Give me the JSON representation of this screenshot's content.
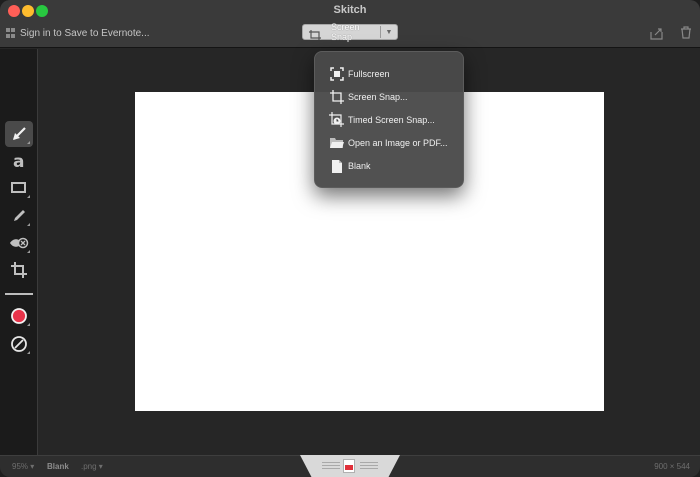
{
  "window": {
    "title": "Skitch"
  },
  "toolbar": {
    "signin_label": "Sign in to Save to Evernote...",
    "capture_button_label": "Screen Snap"
  },
  "menu": {
    "items": [
      {
        "label": "Fullscreen",
        "icon": "fullscreen-icon"
      },
      {
        "label": "Screen Snap...",
        "icon": "screen-snap-icon"
      },
      {
        "label": "Timed Screen Snap...",
        "icon": "timer-icon"
      },
      {
        "label": "Open an Image or PDF...",
        "icon": "folder-icon"
      },
      {
        "label": "Blank",
        "icon": "document-icon"
      }
    ]
  },
  "tools": [
    {
      "name": "arrow-tool",
      "selected": true
    },
    {
      "name": "text-tool"
    },
    {
      "name": "shape-tool"
    },
    {
      "name": "pen-tool"
    },
    {
      "name": "pixelate-tool"
    },
    {
      "name": "crop-tool"
    },
    {
      "name": "color-picker"
    },
    {
      "name": "stroke-size-picker"
    }
  ],
  "colors": {
    "accent_color": "#e8334a",
    "canvas": "#ffffff"
  },
  "statusbar": {
    "zoom": "95% ▾",
    "filename": "Blank",
    "format": ".png ▾",
    "dimensions": "900 × 544"
  }
}
